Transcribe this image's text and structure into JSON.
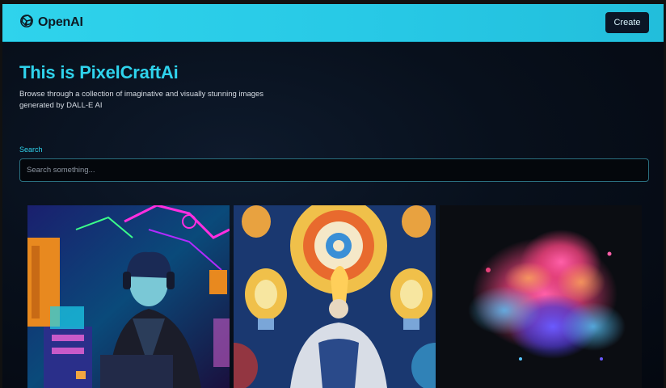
{
  "header": {
    "brand": "OpenAI",
    "logo_icon": "openai-logo-icon",
    "create_label": "Create"
  },
  "hero": {
    "title": "This is PixelCraftAi",
    "description": "Browse through a collection of imaginative and visually stunning images generated by DALL-E AI"
  },
  "search": {
    "label": "Search",
    "value": "",
    "placeholder": "Search something..."
  },
  "gallery": {
    "items": [
      {
        "subject": "neon cyberpunk person at desk"
      },
      {
        "subject": "colorful painting of light bulbs"
      },
      {
        "subject": "colorful powder explosion"
      }
    ]
  },
  "colors": {
    "accent": "#2fd3ec",
    "background": "#08101c",
    "button": "#0b1626"
  }
}
